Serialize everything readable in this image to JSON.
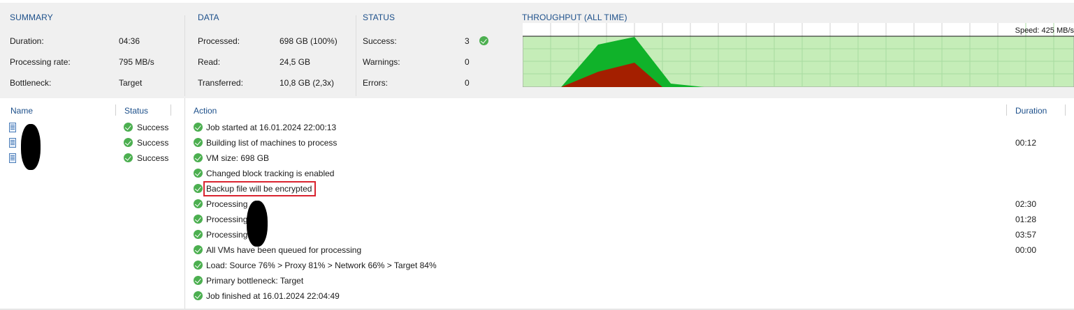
{
  "summary": {
    "title": "SUMMARY",
    "duration_label": "Duration:",
    "duration_value": "04:36",
    "rate_label": "Processing rate:",
    "rate_value": "795 MB/s",
    "bottleneck_label": "Bottleneck:",
    "bottleneck_value": "Target"
  },
  "data": {
    "title": "DATA",
    "processed_label": "Processed:",
    "processed_value": "698 GB (100%)",
    "read_label": "Read:",
    "read_value": "24,5 GB",
    "transferred_label": "Transferred:",
    "transferred_value": "10,8 GB (2,3x)"
  },
  "status": {
    "title": "STATUS",
    "success_label": "Success:",
    "success_value": "3",
    "warnings_label": "Warnings:",
    "warnings_value": "0",
    "errors_label": "Errors:",
    "errors_value": "0"
  },
  "throughput": {
    "title": "THROUGHPUT (ALL TIME)",
    "speed_label": "Speed: 425 MB/s",
    "colors": {
      "background": "#c5edb8",
      "grid": "#a8dca0",
      "read": "#10b22a",
      "transfer": "#a41f00"
    }
  },
  "vm_table": {
    "headers": {
      "name": "Name",
      "status": "Status"
    },
    "rows": [
      {
        "status": "Success"
      },
      {
        "status": "Success"
      },
      {
        "status": "Success"
      }
    ]
  },
  "action_table": {
    "headers": {
      "action": "Action",
      "duration": "Duration"
    },
    "rows": [
      {
        "action": "Job started at 16.01.2024 22:00:13",
        "duration": ""
      },
      {
        "action": "Building list of machines to process",
        "duration": "00:12"
      },
      {
        "action": "VM size: 698 GB",
        "duration": ""
      },
      {
        "action": "Changed block tracking is enabled",
        "duration": ""
      },
      {
        "action": "Backup file will be encrypted",
        "duration": ""
      },
      {
        "action": "Processing",
        "duration": "02:30"
      },
      {
        "action": "Processing",
        "duration": "01:28"
      },
      {
        "action": "Processing",
        "duration": "03:57"
      },
      {
        "action": "All VMs have been queued for processing",
        "duration": "00:00"
      },
      {
        "action": "Load: Source 76% > Proxy 81% > Network 66% > Target 84%",
        "duration": ""
      },
      {
        "action": "Primary bottleneck: Target",
        "duration": ""
      },
      {
        "action": "Job finished at 16.01.2024 22:04:49",
        "duration": ""
      }
    ]
  }
}
